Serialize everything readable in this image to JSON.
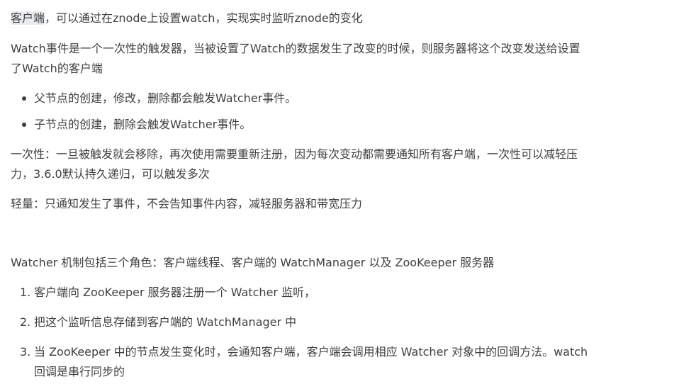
{
  "intro": {
    "highlight": "客户端",
    "rest": "，可以通过在znode上设置watch，实现实时监听znode的变化"
  },
  "watch_event": {
    "line1": "Watch事件是一个一次性的触发器，当被设置了Watch的数据发生了改变的时候，则服务器将这个改变发送给设置",
    "line2": "了Watch的客户端"
  },
  "bullets": [
    "父节点的创建，修改，删除都会触发Watcher事件。",
    "子节点的创建，删除会触发Watcher事件。"
  ],
  "one_time": {
    "line1": "一次性：一旦被触发就会移除，再次使用需要重新注册，因为每次变动都需要通知所有客户端，一次性可以减轻压",
    "line2": "力，3.6.0默认持久递归，可以触发多次"
  },
  "lightweight": "轻量：只通知发生了事件，不会告知事件内容，减轻服务器和带宽压力",
  "roles": "Watcher 机制包括三个角色：客户端线程、客户端的 WatchManager 以及 ZooKeeper 服务器",
  "steps": [
    {
      "num": "1.",
      "lines": [
        "客户端向 ZooKeeper 服务器注册一个 Watcher 监听，"
      ]
    },
    {
      "num": "2.",
      "lines": [
        "把这个监听信息存储到客户端的 WatchManager 中"
      ]
    },
    {
      "num": "3.",
      "lines": [
        "当 ZooKeeper 中的节点发生变化时，会通知客户端，客户端会调用相应 Watcher 对象中的回调方法。watch",
        "回调是串行同步的"
      ]
    }
  ]
}
